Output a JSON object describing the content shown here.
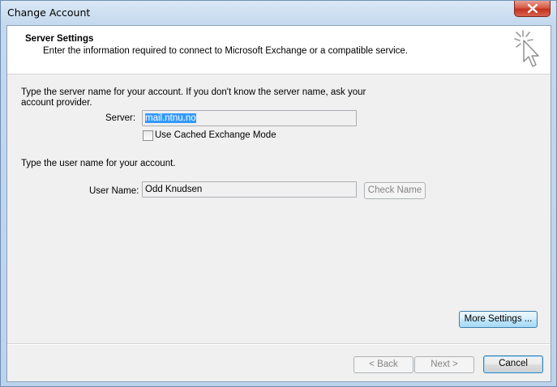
{
  "window": {
    "title": "Change Account"
  },
  "header": {
    "title": "Server Settings",
    "description": "Enter the information required to connect to Microsoft Exchange or a compatible service."
  },
  "server_section": {
    "instruction_line1": "Type the server name for your account. If you don't know the server name, ask your",
    "instruction_line2": "account provider.",
    "server_label": "Server:",
    "server_value": "mail.ntnu.no",
    "cached_mode_label": "Use Cached Exchange Mode",
    "cached_mode_checked": false
  },
  "user_section": {
    "instruction": "Type the user name for your account.",
    "user_label": "User Name:",
    "user_value": "Odd Knudsen",
    "check_name_label": "Check Name"
  },
  "buttons": {
    "more_settings": "More Settings ...",
    "back": "< Back",
    "next": "Next >",
    "cancel": "Cancel"
  },
  "icons": {
    "close": "close-icon",
    "wizard": "cursor-sparkle-icon"
  }
}
